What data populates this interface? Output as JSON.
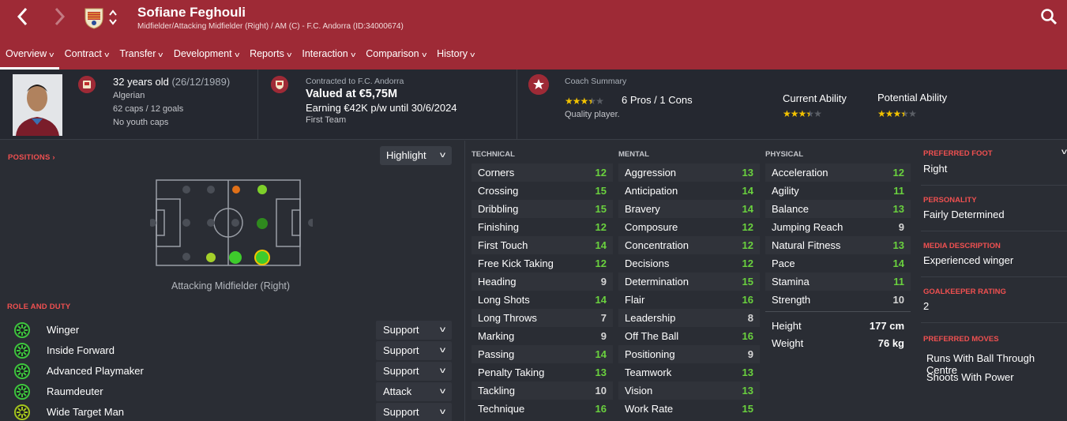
{
  "header": {
    "name": "Sofiane Feghouli",
    "subtitle": "Midfielder/Attacking Midfielder (Right) / AM (C) - F.C. Andorra (ID:34000674)"
  },
  "tabs": [
    {
      "label": "Overview"
    },
    {
      "label": "Contract"
    },
    {
      "label": "Transfer"
    },
    {
      "label": "Development"
    },
    {
      "label": "Reports"
    },
    {
      "label": "Interaction"
    },
    {
      "label": "Comparison"
    },
    {
      "label": "History"
    }
  ],
  "profile": {
    "age": "32 years old",
    "dob": "(26/12/1989)",
    "nationality": "Algerian",
    "caps": "62 caps / 12 goals",
    "youth": "No youth caps"
  },
  "contract": {
    "label": "Contracted to F.C. Andorra",
    "value": "Valued at €5,75M",
    "wage": "Earning €42K p/w until 30/6/2024",
    "squad": "First Team"
  },
  "coach": {
    "title": "Coach Summary",
    "stars": 3.5,
    "pros_cons": "6 Pros / 1 Cons",
    "summary": "Quality player."
  },
  "ability": {
    "current_label": "Current Ability",
    "current_stars": 3.5,
    "potential_label": "Potential Ability",
    "potential_stars": 3.5
  },
  "positions": {
    "label": "POSITIONS ›",
    "highlight": "Highlight",
    "caption": "Attacking Midfielder (Right)"
  },
  "role_section": "ROLE AND DUTY",
  "roles": [
    {
      "name": "Winger",
      "duty": "Support",
      "color": "#3ec43e"
    },
    {
      "name": "Inside Forward",
      "duty": "Support",
      "color": "#3ec43e"
    },
    {
      "name": "Advanced Playmaker",
      "duty": "Support",
      "color": "#3ec43e"
    },
    {
      "name": "Raumdeuter",
      "duty": "Attack",
      "color": "#3ec43e"
    },
    {
      "name": "Wide Target Man",
      "duty": "Support",
      "color": "#a4c41e"
    }
  ],
  "technical": {
    "title": "TECHNICAL",
    "attrs": [
      {
        "n": "Corners",
        "v": "12"
      },
      {
        "n": "Crossing",
        "v": "15"
      },
      {
        "n": "Dribbling",
        "v": "15"
      },
      {
        "n": "Finishing",
        "v": "12"
      },
      {
        "n": "First Touch",
        "v": "14"
      },
      {
        "n": "Free Kick Taking",
        "v": "12"
      },
      {
        "n": "Heading",
        "v": "9"
      },
      {
        "n": "Long Shots",
        "v": "14"
      },
      {
        "n": "Long Throws",
        "v": "7"
      },
      {
        "n": "Marking",
        "v": "9"
      },
      {
        "n": "Passing",
        "v": "14"
      },
      {
        "n": "Penalty Taking",
        "v": "13"
      },
      {
        "n": "Tackling",
        "v": "10"
      },
      {
        "n": "Technique",
        "v": "16"
      }
    ]
  },
  "mental": {
    "title": "MENTAL",
    "attrs": [
      {
        "n": "Aggression",
        "v": "13"
      },
      {
        "n": "Anticipation",
        "v": "14"
      },
      {
        "n": "Bravery",
        "v": "14"
      },
      {
        "n": "Composure",
        "v": "12"
      },
      {
        "n": "Concentration",
        "v": "12"
      },
      {
        "n": "Decisions",
        "v": "12"
      },
      {
        "n": "Determination",
        "v": "15"
      },
      {
        "n": "Flair",
        "v": "16"
      },
      {
        "n": "Leadership",
        "v": "8"
      },
      {
        "n": "Off The Ball",
        "v": "16"
      },
      {
        "n": "Positioning",
        "v": "9"
      },
      {
        "n": "Teamwork",
        "v": "13"
      },
      {
        "n": "Vision",
        "v": "13"
      },
      {
        "n": "Work Rate",
        "v": "15"
      }
    ]
  },
  "physical": {
    "title": "PHYSICAL",
    "attrs": [
      {
        "n": "Acceleration",
        "v": "12"
      },
      {
        "n": "Agility",
        "v": "11"
      },
      {
        "n": "Balance",
        "v": "13"
      },
      {
        "n": "Jumping Reach",
        "v": "9"
      },
      {
        "n": "Natural Fitness",
        "v": "13"
      },
      {
        "n": "Pace",
        "v": "14"
      },
      {
        "n": "Stamina",
        "v": "11"
      },
      {
        "n": "Strength",
        "v": "10"
      }
    ],
    "height_label": "Height",
    "height": "177 cm",
    "weight_label": "Weight",
    "weight": "76 kg"
  },
  "side": {
    "foot_label": "PREFERRED FOOT",
    "foot": "Right",
    "personality_label": "PERSONALITY",
    "personality": "Fairly Determined",
    "media_label": "MEDIA DESCRIPTION",
    "media": "Experienced winger",
    "gk_label": "GOALKEEPER RATING",
    "gk": "2",
    "moves_label": "PREFERRED MOVES",
    "moves": [
      "Runs With Ball Through Centre",
      "Shoots With Power"
    ]
  },
  "colors": {
    "header": "#9e2a36",
    "accent_red": "#f05050",
    "attr_high": "#6ad13e",
    "attr_mid": "#d6d6d6",
    "star": "#f2c200",
    "pos_natural": "#3ecb2c",
    "pos_good": "#2f8a1e",
    "pos_poor": "#e07018"
  }
}
